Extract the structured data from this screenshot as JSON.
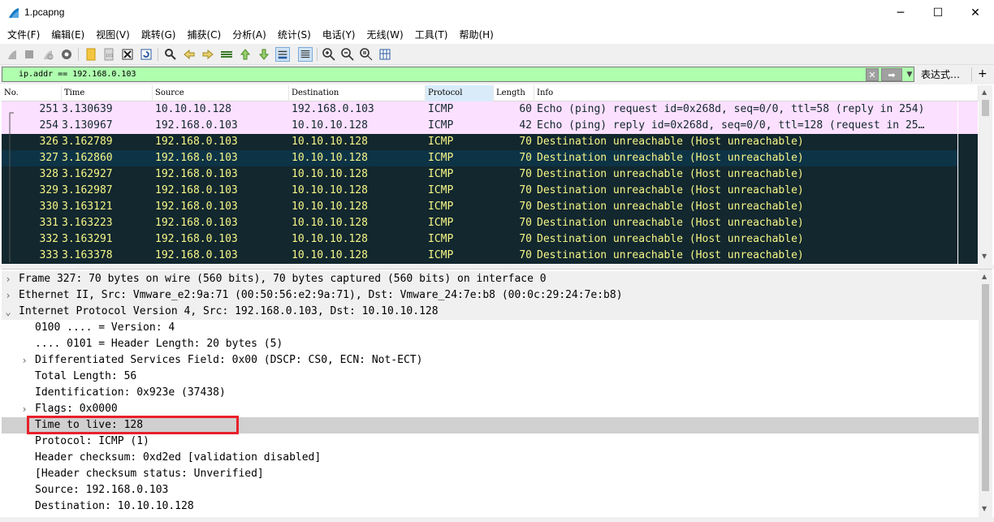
{
  "window": {
    "title": "1.pcapng"
  },
  "menu": [
    "文件(F)",
    "编辑(E)",
    "视图(V)",
    "跳转(G)",
    "捕获(C)",
    "分析(A)",
    "统计(S)",
    "电话(Y)",
    "无线(W)",
    "工具(T)",
    "帮助(H)"
  ],
  "filter": {
    "value": "ip.addr == 192.168.0.103",
    "expression_label": "表达式…",
    "plus_label": "+"
  },
  "columns": [
    "No.",
    "Time",
    "Source",
    "Destination",
    "Protocol",
    "Length",
    "Info"
  ],
  "packets": [
    {
      "no": "251",
      "time": "3.130639",
      "src": "10.10.10.128",
      "dst": "192.168.0.103",
      "proto": "ICMP",
      "len": "60",
      "info": "Echo (ping) request  id=0x268d, seq=0/0, ttl=58 (reply in 254)",
      "style": "pink"
    },
    {
      "no": "254",
      "time": "3.130967",
      "src": "192.168.0.103",
      "dst": "10.10.10.128",
      "proto": "ICMP",
      "len": "42",
      "info": "Echo (ping) reply    id=0x268d, seq=0/0, ttl=128 (request in 25…",
      "style": "pink"
    },
    {
      "no": "326",
      "time": "3.162789",
      "src": "192.168.0.103",
      "dst": "10.10.10.128",
      "proto": "ICMP",
      "len": "70",
      "info": "Destination unreachable (Host unreachable)",
      "style": "dark"
    },
    {
      "no": "327",
      "time": "3.162860",
      "src": "192.168.0.103",
      "dst": "10.10.10.128",
      "proto": "ICMP",
      "len": "70",
      "info": "Destination unreachable (Host unreachable)",
      "style": "selected"
    },
    {
      "no": "328",
      "time": "3.162927",
      "src": "192.168.0.103",
      "dst": "10.10.10.128",
      "proto": "ICMP",
      "len": "70",
      "info": "Destination unreachable (Host unreachable)",
      "style": "dark"
    },
    {
      "no": "329",
      "time": "3.162987",
      "src": "192.168.0.103",
      "dst": "10.10.10.128",
      "proto": "ICMP",
      "len": "70",
      "info": "Destination unreachable (Host unreachable)",
      "style": "dark"
    },
    {
      "no": "330",
      "time": "3.163121",
      "src": "192.168.0.103",
      "dst": "10.10.10.128",
      "proto": "ICMP",
      "len": "70",
      "info": "Destination unreachable (Host unreachable)",
      "style": "dark"
    },
    {
      "no": "331",
      "time": "3.163223",
      "src": "192.168.0.103",
      "dst": "10.10.10.128",
      "proto": "ICMP",
      "len": "70",
      "info": "Destination unreachable (Host unreachable)",
      "style": "dark"
    },
    {
      "no": "332",
      "time": "3.163291",
      "src": "192.168.0.103",
      "dst": "10.10.10.128",
      "proto": "ICMP",
      "len": "70",
      "info": "Destination unreachable (Host unreachable)",
      "style": "dark"
    },
    {
      "no": "333",
      "time": "3.163378",
      "src": "192.168.0.103",
      "dst": "10.10.10.128",
      "proto": "ICMP",
      "len": "70",
      "info": "Destination unreachable (Host unreachable)",
      "style": "dark"
    }
  ],
  "details": [
    {
      "text": "Frame 327: 70 bytes on wire (560 bits), 70 bytes captured (560 bits) on interface 0",
      "level": 0,
      "arrow": "collapsed",
      "style": "header"
    },
    {
      "text": "Ethernet II, Src: Vmware_e2:9a:71 (00:50:56:e2:9a:71), Dst: Vmware_24:7e:b8 (00:0c:29:24:7e:b8)",
      "level": 0,
      "arrow": "collapsed",
      "style": "header"
    },
    {
      "text": "Internet Protocol Version 4, Src: 192.168.0.103, Dst: 10.10.10.128",
      "level": 0,
      "arrow": "expanded",
      "style": "header"
    },
    {
      "text": "0100 .... = Version: 4",
      "level": 1,
      "arrow": "none",
      "style": "normal"
    },
    {
      "text": ".... 0101 = Header Length: 20 bytes (5)",
      "level": 1,
      "arrow": "none",
      "style": "normal"
    },
    {
      "text": "Differentiated Services Field: 0x00 (DSCP: CS0, ECN: Not-ECT)",
      "level": 1,
      "arrow": "collapsed",
      "style": "normal"
    },
    {
      "text": "Total Length: 56",
      "level": 1,
      "arrow": "none",
      "style": "normal"
    },
    {
      "text": "Identification: 0x923e (37438)",
      "level": 1,
      "arrow": "none",
      "style": "normal"
    },
    {
      "text": "Flags: 0x0000",
      "level": 1,
      "arrow": "collapsed",
      "style": "normal"
    },
    {
      "text": "Time to live: 128",
      "level": 1,
      "arrow": "none",
      "style": "selected"
    },
    {
      "text": "Protocol: ICMP (1)",
      "level": 1,
      "arrow": "none",
      "style": "normal"
    },
    {
      "text": "Header checksum: 0xd2ed [validation disabled]",
      "level": 1,
      "arrow": "none",
      "style": "normal"
    },
    {
      "text": "[Header checksum status: Unverified]",
      "level": 1,
      "arrow": "none",
      "style": "normal"
    },
    {
      "text": "Source: 192.168.0.103",
      "level": 1,
      "arrow": "none",
      "style": "normal"
    },
    {
      "text": "Destination: 10.10.10.128",
      "level": 1,
      "arrow": "none",
      "style": "normal"
    }
  ],
  "colors": {
    "pink_bg": "#fce0ff",
    "dark_bg": "#12272e",
    "dark_fg": "#f7f787",
    "selected_bg": "#0d3346",
    "detail_header_bg": "#f0f0f0",
    "detail_selected_bg": "#d0d0d0",
    "highlight_box": "#e8202a",
    "filter_bg": "#afffaf"
  }
}
